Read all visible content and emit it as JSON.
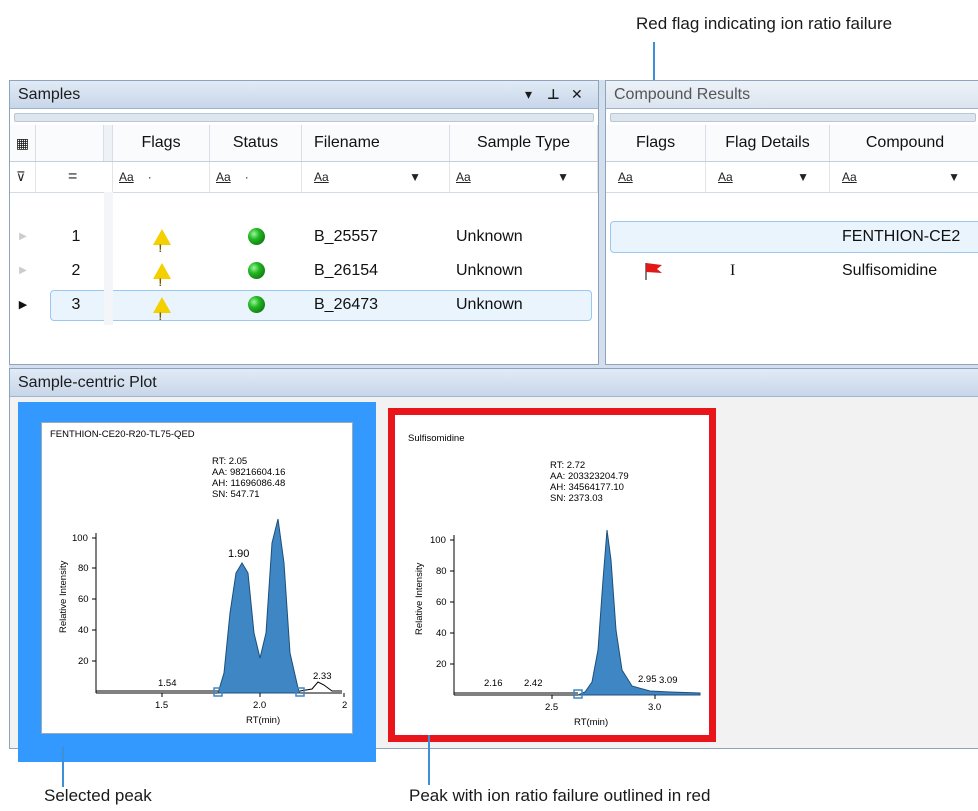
{
  "callouts": {
    "top": "Red flag indicating ion ratio failure",
    "bottom_left": "Selected peak",
    "bottom_right": "Peak with ion ratio failure outlined in red"
  },
  "samples_panel": {
    "title": "Samples",
    "controls": {
      "dropdown": "▾",
      "pin": "⊥",
      "close": "✕"
    },
    "columns": [
      "Flags",
      "Status",
      "Filename",
      "Sample Type"
    ],
    "filter_aa": "Aa",
    "rows": [
      {
        "index": "1",
        "filename": "B_25557",
        "sample_type": "Unknown",
        "selected": false
      },
      {
        "index": "2",
        "filename": "B_26154",
        "sample_type": "Unknown",
        "selected": false
      },
      {
        "index": "3",
        "filename": "B_26473",
        "sample_type": "Unknown",
        "selected": true
      }
    ]
  },
  "compound_panel": {
    "title": "Compound Results",
    "columns": [
      "Flags",
      "Flag Details",
      "Compound"
    ],
    "rows": [
      {
        "flag_details": "",
        "compound": "FENTHION-CE2"
      },
      {
        "flag_details": "I",
        "compound": "Sulfisomidine"
      }
    ]
  },
  "plot_panel": {
    "title": "Sample-centric Plot",
    "ylabel": "Relative Intensity",
    "xlabel": "RT(min)",
    "plots": [
      {
        "name": "FENTHION-CE20-R20-TL75-QED",
        "rt": "RT: 2.05",
        "aa": "AA: 98216604.16",
        "ah": "AH: 11696086.48",
        "sn": "SN: 547.71",
        "yticks": [
          "100",
          "80",
          "60",
          "40",
          "20"
        ],
        "xticks": [
          "1.5",
          "2.0",
          "2"
        ],
        "peak_labels": [
          "1.90",
          "1.54",
          "2.33"
        ]
      },
      {
        "name": "Sulfisomidine",
        "rt": "RT: 2.72",
        "aa": "AA: 203323204.79",
        "ah": "AH: 34564177.10",
        "sn": "SN: 2373.03",
        "yticks": [
          "100",
          "80",
          "60",
          "40",
          "20"
        ],
        "xticks": [
          "2.5",
          "3.0"
        ],
        "peak_labels": [
          "2.16",
          "2.42",
          "2.95",
          "3.09"
        ]
      }
    ]
  },
  "colors": {
    "selected_border": "#3399ff",
    "failure_border": "#e8161b",
    "peak_fill": "#3f86c4",
    "leader": "#3d8fd8"
  }
}
